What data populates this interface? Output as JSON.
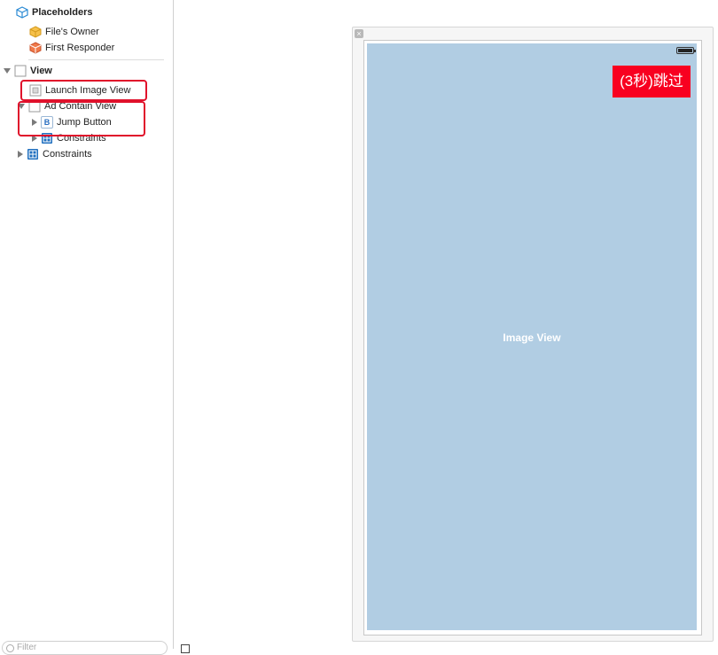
{
  "outline": {
    "placeholders": "Placeholders",
    "files_owner": "File's Owner",
    "first_responder": "First Responder",
    "view": "View",
    "launch_image_view": "Launch Image View",
    "ad_contain_view": "Ad Contain View",
    "jump_button": "Jump Button",
    "jump_button_glyph": "B",
    "constraints_inner": "Constraints",
    "constraints_outer": "Constraints",
    "filter_placeholder": "Filter"
  },
  "canvas": {
    "image_view_label": "Image View",
    "skip_button_label": "(3秒)跳过"
  },
  "colors": {
    "highlight": "#e0112b",
    "image_view_bg": "#b1cde3",
    "skip_button_bg": "#f80020"
  },
  "icons": {
    "placeholders": "cube-icon",
    "files_owner": "yellow-cube-icon",
    "first_responder": "red-cube-icon",
    "view": "view-icon",
    "launch_image_view": "image-view-icon",
    "ad_contain_view": "view-icon",
    "jump_button": "button-icon",
    "constraints": "constraints-icon",
    "battery": "battery-icon"
  }
}
